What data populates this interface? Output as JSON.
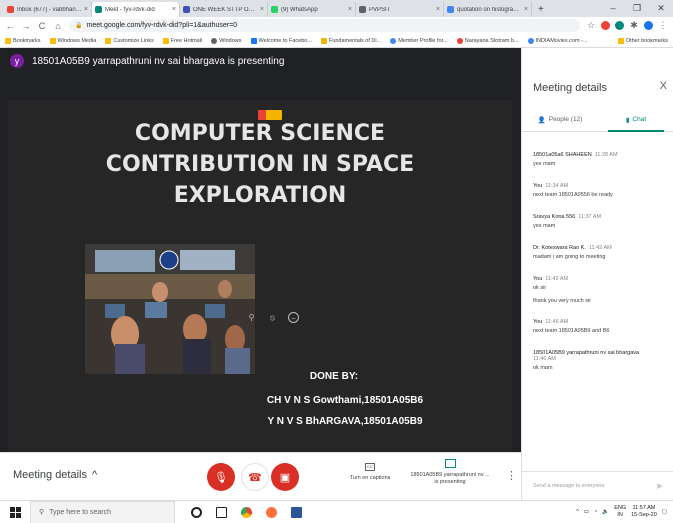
{
  "browser": {
    "tabs": [
      {
        "title": "Inbox (677) - vabbhanenum@…",
        "favicon_color": "#ea4335",
        "active": false
      },
      {
        "title": "Meet - fyv-rdvk-did",
        "favicon_color": "#00897b",
        "active": true
      },
      {
        "title": "ONE WEEK STTP ON MACHINE",
        "favicon_color": "#3f51b5",
        "active": false
      },
      {
        "title": "(9) WhatsApp",
        "favicon_color": "#25d366",
        "active": false
      },
      {
        "title": "PVPSIT",
        "favicon_color": "#5f6368",
        "active": false
      },
      {
        "title": "quotation on histogram - Go…",
        "favicon_color": "#4285f4",
        "active": false
      }
    ],
    "new_tab": "+",
    "window_controls": [
      "–",
      "❐",
      "✕"
    ],
    "url": "meet.google.com/fyv-rdvk-did?pli=1&authuser=0",
    "bookmarks": [
      {
        "label": "Bookmarks",
        "color": "#fbbc04"
      },
      {
        "label": "Windows Media",
        "color": "#fbbc04"
      },
      {
        "label": "Customize Links",
        "color": "#fbbc04"
      },
      {
        "label": "Free Hotmail",
        "color": "#fbbc04"
      },
      {
        "label": "Windows",
        "color": "#5f6368"
      },
      {
        "label": "Welcome to Facebo...",
        "color": "#1877f2"
      },
      {
        "label": "Fundamentals of Di...",
        "color": "#f4b400"
      },
      {
        "label": "Member Profile for...",
        "color": "#4285f4"
      },
      {
        "label": "Narayana Stotram b...",
        "color": "#ea4335"
      },
      {
        "label": "INDIAMovies.com -...",
        "color": "#4285f4"
      }
    ],
    "other_bookmarks": "Other bookmarks"
  },
  "meet": {
    "presenter_avatar": "y",
    "presenter_text": "18501A05B9 yarrapathruni nv sai bhargava is presenting",
    "slide": {
      "title_lines": [
        "COMPUTER SCIENCE",
        "CONTRIBUTION IN SPACE",
        "EXPLORATION"
      ],
      "done_by": "DONE BY:",
      "credit_1": "CH V N S Gowthami,18501A05B6",
      "credit_2": "Y N V S BhARGAVA,18501A05B9"
    }
  },
  "panel": {
    "title": "Meeting details",
    "close": "X",
    "tabs": [
      {
        "label": "People (12)",
        "icon": "people-icon",
        "active": false
      },
      {
        "label": "Chat",
        "icon": "chat-icon",
        "active": true
      }
    ],
    "messages": [
      {
        "sender": "18501a05a6 SHAHEEN",
        "time": "11:28 AM",
        "lines": [
          "yes mam"
        ]
      },
      {
        "sender": "You",
        "time": "11:34 AM",
        "lines": [
          "next team 18501A0556  be ready"
        ]
      },
      {
        "sender": "Sravya Kona 556",
        "time": "11:37 AM",
        "lines": [
          "yes mam"
        ]
      },
      {
        "sender": "Dr. Koteswara Rao K.",
        "time": "11:42 AM",
        "lines": [
          "madam i am going to meeting"
        ]
      },
      {
        "sender": "You",
        "time": "11:42 AM",
        "lines": [
          "ok sir",
          "thank you very much sir"
        ]
      },
      {
        "sender": "You",
        "time": "11:46 AM",
        "lines": [
          "next team 18501A05B9  and B6"
        ]
      },
      {
        "sender": "18501A05B9 yarrapathruni nv sai bhargava",
        "time": "11:46 AM",
        "lines": [
          "ok mam"
        ]
      }
    ],
    "input_placeholder": "Send a message to everyone"
  },
  "bottombar": {
    "meeting_details": "Meeting details",
    "captions": "Turn on captions",
    "presenting_line1": "18501A05B9 yarrapathruni nv ...",
    "presenting_line2": "is presenting"
  },
  "taskbar": {
    "search_placeholder": "Type here to search",
    "lang": "ENG",
    "region": "IN",
    "time": "11:57 AM",
    "date": "15-Sep-20"
  }
}
